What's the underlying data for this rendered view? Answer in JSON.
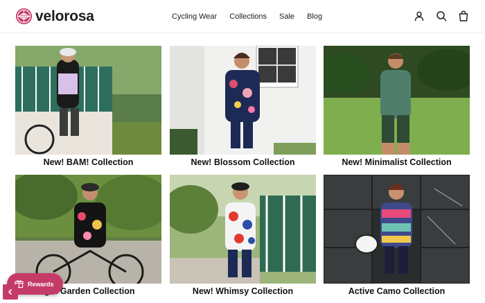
{
  "brand": {
    "name": "velorosa",
    "accent_color": "#c53b67"
  },
  "nav": {
    "items": [
      {
        "label": "Cycling Wear"
      },
      {
        "label": "Collections"
      },
      {
        "label": "Sale"
      },
      {
        "label": "Blog"
      }
    ]
  },
  "header_icons": [
    {
      "name": "account-icon"
    },
    {
      "name": "search-icon"
    },
    {
      "name": "cart-icon"
    }
  ],
  "collections": [
    {
      "title": "New! BAM! Collection"
    },
    {
      "title": "New! Blossom Collection"
    },
    {
      "title": "New! Minimalist Collection"
    },
    {
      "title": "ight Garden Collection"
    },
    {
      "title": "New! Whimsy Collection"
    },
    {
      "title": "Active Camo Collection"
    }
  ],
  "rewards": {
    "label": "Rewards",
    "icon": "gift-icon"
  },
  "corner_button": {
    "icon": "chevron-left-icon"
  }
}
